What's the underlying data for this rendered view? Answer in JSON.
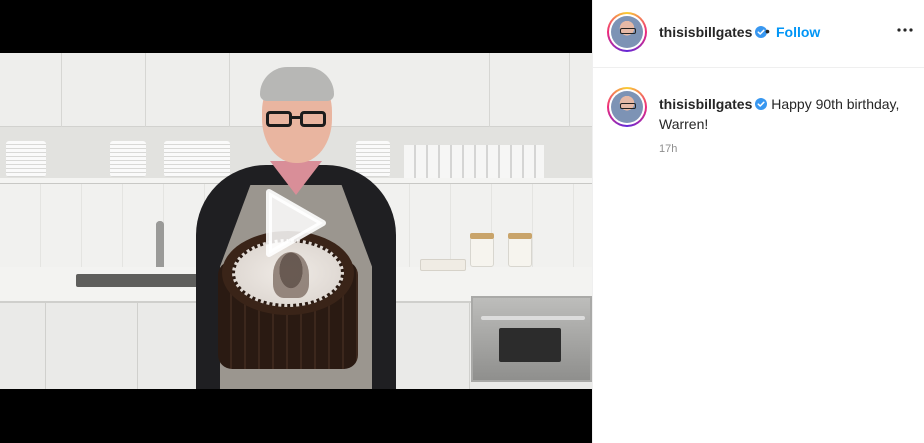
{
  "post": {
    "author": {
      "username": "thisisbillgates",
      "verified": true,
      "follow_label": "Follow",
      "separator": "•"
    },
    "caption": {
      "username": "thisisbillgates",
      "text": "Happy 90th birthday, Warren!"
    },
    "timestamp": "17h",
    "media": {
      "type": "video",
      "play_icon": "play-icon"
    }
  },
  "icons": {
    "verified": "verified-badge-icon",
    "more": "more-options-icon"
  },
  "colors": {
    "link_blue": "#0095f6",
    "verified_blue": "#3897f0",
    "text_primary": "#262626",
    "text_secondary": "#8e8e8e",
    "media_bg": "#000000"
  }
}
